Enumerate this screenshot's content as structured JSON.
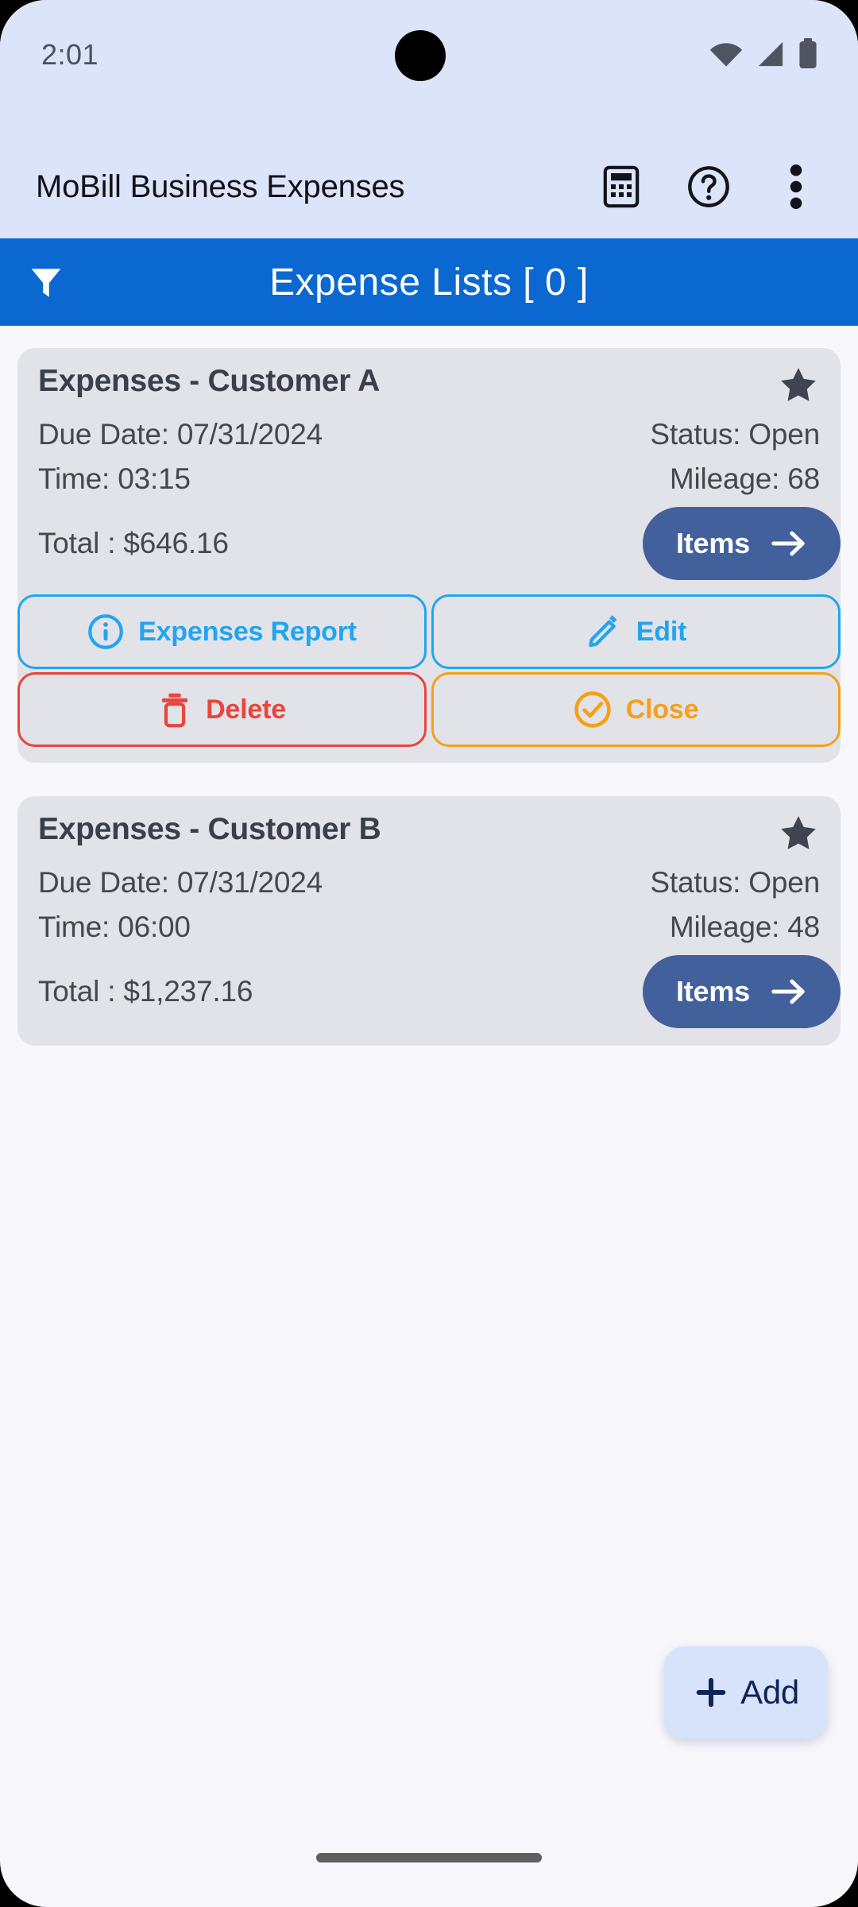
{
  "status_bar": {
    "time": "2:01",
    "icons": [
      "wifi-icon",
      "cellular-signal-icon",
      "battery-icon"
    ]
  },
  "app_bar": {
    "title": "MoBill Business Expenses",
    "actions": [
      {
        "name": "calculator-icon",
        "label": "Calculator"
      },
      {
        "name": "help-icon",
        "label": "Help"
      },
      {
        "name": "overflow-menu-icon",
        "label": "More options"
      }
    ]
  },
  "section_header": {
    "title": "Expense Lists [ 0 ]",
    "filter_icon": "filter-funnel-icon",
    "background_color": "#0A68D0"
  },
  "colors": {
    "accent_blue": "#0A68D0",
    "items_button": "#42609B",
    "outline_blue": "#21A5EF",
    "outline_red": "#E8453C",
    "outline_orange": "#F4A01B",
    "card_bg": "#E2E2E9",
    "page_bg": "#F8F8FC",
    "fab_bg": "#D7E2FB",
    "fab_text": "#0E2454"
  },
  "expense_lists": [
    {
      "title": "Expenses - Customer A",
      "favorite": true,
      "due_date": "Due Date: 07/31/2024",
      "status": "Status: Open",
      "time": "Time: 03:15",
      "mileage": "Mileage: 68",
      "total": "Total : $646.16",
      "items_label": "Items",
      "actions": [
        {
          "label": "Expenses Report",
          "icon": "info-circle-icon",
          "style": "blue"
        },
        {
          "label": "Edit",
          "icon": "pencil-icon",
          "style": "blue"
        },
        {
          "label": "Delete",
          "icon": "trash-icon",
          "style": "red"
        },
        {
          "label": "Close",
          "icon": "check-circle-icon",
          "style": "orange"
        }
      ]
    },
    {
      "title": "Expenses - Customer B",
      "favorite": true,
      "due_date": "Due Date: 07/31/2024",
      "status": "Status: Open",
      "time": "Time: 06:00",
      "mileage": "Mileage: 48",
      "total": "Total : $1,237.16",
      "items_label": "Items",
      "actions": []
    }
  ],
  "fab": {
    "label": "Add",
    "icon": "plus-icon"
  }
}
